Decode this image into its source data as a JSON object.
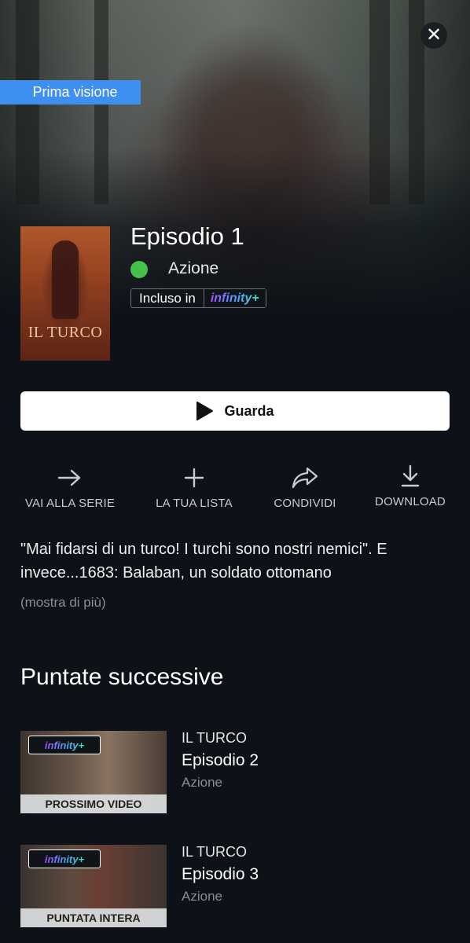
{
  "hero": {
    "badge": "Prima visione",
    "close_icon": "close-icon"
  },
  "episode": {
    "poster_title": "IL TURCO",
    "title": "Episodio 1",
    "genre": "Azione",
    "genre_color": "#45c24a",
    "included_label": "Incluso in",
    "brand": "infinity+"
  },
  "watch_button": {
    "label": "Guarda"
  },
  "actions": [
    {
      "label": "VAI ALLA SERIE",
      "icon": "arrow-right-icon"
    },
    {
      "label": "LA TUA LISTA",
      "icon": "plus-icon"
    },
    {
      "label": "CONDIVIDI",
      "icon": "share-icon"
    },
    {
      "label": "DOWNLOAD",
      "icon": "download-icon"
    }
  ],
  "description": {
    "text": "\"Mai fidarsi di un turco! I turchi sono nostri nemici\". E invece...1683: Balaban, un soldato ottomano",
    "more": "(mostra di più)"
  },
  "next_section": {
    "title": "Puntate successive",
    "items": [
      {
        "brand": "infinity+",
        "strip": "PROSSIMO VIDEO",
        "series": "IL TURCO",
        "name": "Episodio 2",
        "genre": "Azione"
      },
      {
        "brand": "infinity+",
        "strip": "PUNTATA INTERA",
        "series": "IL TURCO",
        "name": "Episodio 3",
        "genre": "Azione"
      }
    ]
  },
  "colors": {
    "badge": "#3e8ff0",
    "background": "#0c1217"
  }
}
